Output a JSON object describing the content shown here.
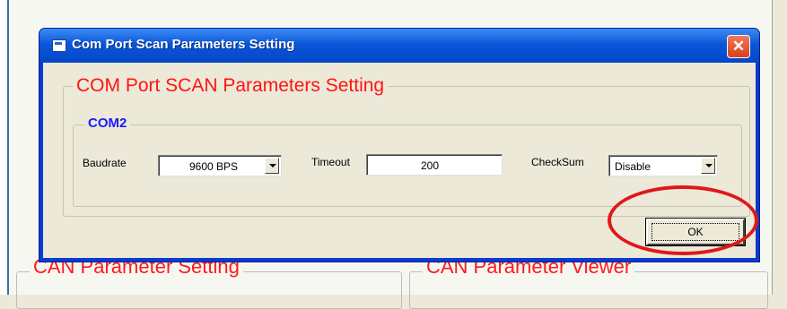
{
  "dialog": {
    "title": "Com Port Scan Parameters Setting",
    "close_symbol": "✕",
    "group_title": "COM Port SCAN Parameters Setting",
    "port_group_title": "COM2",
    "baudrate_label": "Baudrate",
    "baudrate_value": "9600 BPS",
    "timeout_label": "Timeout",
    "timeout_value": "200",
    "checksum_label": "CheckSum",
    "checksum_value": "Disable",
    "ok_label": "OK"
  },
  "background": {
    "panel_left_title": "CAN Parameter Setting",
    "panel_right_title": "CAN Parameter Viewer"
  },
  "colors": {
    "group_title": "#ff1414",
    "port_title": "#1a1aff",
    "titlebar": "#0a56d8",
    "highlight": "#e01818"
  }
}
